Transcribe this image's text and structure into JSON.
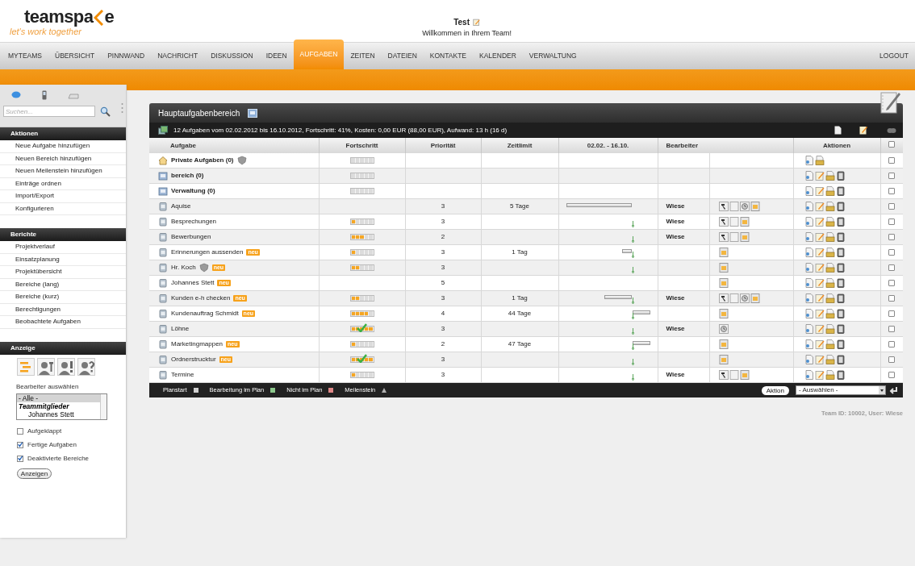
{
  "logo": {
    "text_start": "teamspa",
    "text_end": "e",
    "tagline": "let's work together"
  },
  "user": {
    "name": "Test",
    "welcome": "Willkommen in Ihrem Team!"
  },
  "nav": [
    {
      "label": "MYTEAMS",
      "selected": false
    },
    {
      "label": "ÜBERSICHT",
      "selected": false
    },
    {
      "label": "PINNWAND",
      "selected": false
    },
    {
      "label": "NACHRICHT",
      "selected": false
    },
    {
      "label": "DISKUSSION",
      "selected": false
    },
    {
      "label": "IDEEN",
      "selected": false
    },
    {
      "label": "AUFGABEN",
      "selected": true
    },
    {
      "label": "ZEITEN",
      "selected": false
    },
    {
      "label": "DATEIEN",
      "selected": false
    },
    {
      "label": "KONTAKTE",
      "selected": false
    },
    {
      "label": "KALENDER",
      "selected": false
    },
    {
      "label": "VERWALTUNG",
      "selected": false
    }
  ],
  "logout": "LOGOUT",
  "sidebar": {
    "search": {
      "placeholder": "Suchen..."
    },
    "sections": [
      {
        "title": "Aktionen",
        "items": [
          "Neue Aufgabe hinzufügen",
          "Neuen Bereich hinzufügen",
          "Neuen Meilenstein hinzufügen",
          "Einträge ordnen",
          "Import/Export",
          "Konfigurieren"
        ]
      },
      {
        "title": "Berichte",
        "items": [
          "Projektverlauf",
          "Einsatzplanung",
          "Projektübersicht",
          "Bereiche (lang)",
          "Bereiche (kurz)",
          "Berechtigungen",
          "Beobachtete Aufgaben"
        ]
      }
    ],
    "display": {
      "title": "Anzeige",
      "assignee_label": "Bearbeiter auswählen",
      "assignee_options": [
        {
          "label": "- Alle -",
          "kind": "option",
          "selected": true
        },
        {
          "label": "Teammitglieder",
          "kind": "group",
          "selected": false
        },
        {
          "label": "Johannes Stett",
          "kind": "option",
          "selected": false
        }
      ],
      "checkboxes": [
        {
          "label": "Aufgeklappt",
          "checked": false
        },
        {
          "label": "Fertige Aufgaben",
          "checked": true
        },
        {
          "label": "Deaktivierte Bereiche",
          "checked": true
        }
      ],
      "button": "Anzeigen"
    }
  },
  "panel": {
    "title": "Hauptaufgabenbereich",
    "summary": "12 Aufgaben vom 02.02.2012 bis 16.10.2012, Fortschritt: 41%, Kosten: 0,00 EUR (88,00 EUR), Aufwand: 13 h (16 d)",
    "columns": [
      "Aufgabe",
      "Fortschritt",
      "Priorität",
      "Zeitlimit",
      "02.02. - 16.10.",
      "Bearbeiter",
      "Aktionen"
    ],
    "select_all_checked": false,
    "rows": [
      {
        "name": "Private Aufgaben (0)",
        "kind": "home",
        "shield": true,
        "progress": {
          "level": 0,
          "done": false
        },
        "status_icons": [],
        "actions": [
          {
            "kind": "view"
          },
          {
            "kind": "folder"
          }
        ],
        "checked": false
      },
      {
        "name": "bereich (0)",
        "kind": "area",
        "shield": false,
        "progress": {
          "level": 0,
          "done": false
        },
        "status_icons": [],
        "actions": [
          {
            "kind": "view"
          },
          {
            "kind": "edit"
          },
          {
            "kind": "folder"
          },
          {
            "kind": "delete"
          }
        ],
        "checked": false
      },
      {
        "name": "Verwaltung (0)",
        "kind": "area",
        "shield": false,
        "progress": {
          "level": 0,
          "done": false
        },
        "status_icons": [],
        "actions": [
          {
            "kind": "view"
          },
          {
            "kind": "edit"
          },
          {
            "kind": "folder"
          },
          {
            "kind": "delete"
          }
        ],
        "checked": false
      },
      {
        "name": "Aquise",
        "kind": "task",
        "shield": false,
        "priority": "3",
        "time_limit": "5 Tage",
        "timeline": {
          "kind": "past-long"
        },
        "assignee": "Wiese",
        "status_icons": [
          {
            "kind": "hammer"
          },
          {
            "kind": "paper"
          },
          {
            "kind": "clock"
          },
          {
            "kind": "jar"
          }
        ],
        "actions": [
          {
            "kind": "view"
          },
          {
            "kind": "edit"
          },
          {
            "kind": "folder"
          },
          {
            "kind": "delete"
          }
        ],
        "checked": false
      },
      {
        "name": "Besprechungen",
        "kind": "task",
        "shield": false,
        "progress": {
          "level": 0.2,
          "done": false
        },
        "priority": "3",
        "timeline": {
          "kind": "marker"
        },
        "assignee": "Wiese",
        "status_icons": [
          {
            "kind": "hammer"
          },
          {
            "kind": "paper"
          },
          {
            "kind": "jar"
          }
        ],
        "actions": [
          {
            "kind": "view"
          },
          {
            "kind": "edit"
          },
          {
            "kind": "folder"
          },
          {
            "kind": "delete"
          }
        ],
        "checked": false
      },
      {
        "name": "Bewerbungen",
        "kind": "task",
        "shield": false,
        "progress": {
          "level": 0.6,
          "done": false
        },
        "priority": "2",
        "timeline": {
          "kind": "marker"
        },
        "assignee": "Wiese",
        "status_icons": [
          {
            "kind": "hammer"
          },
          {
            "kind": "paper"
          },
          {
            "kind": "jar"
          }
        ],
        "actions": [
          {
            "kind": "view"
          },
          {
            "kind": "edit"
          },
          {
            "kind": "folder"
          },
          {
            "kind": "delete"
          }
        ],
        "checked": false
      },
      {
        "name": "Erinnerungen aussenden",
        "kind": "task",
        "shield": false,
        "badge": "neu",
        "progress": {
          "level": 0.2,
          "done": false
        },
        "priority": "3",
        "time_limit": "1 Tag",
        "timeline": {
          "kind": "past-tiny"
        },
        "status_icons": [
          {
            "kind": "jar"
          }
        ],
        "actions": [
          {
            "kind": "view"
          },
          {
            "kind": "edit"
          },
          {
            "kind": "folder"
          },
          {
            "kind": "delete"
          }
        ],
        "checked": false
      },
      {
        "name": "Hr. Koch",
        "kind": "task",
        "shield": true,
        "badge": "neu",
        "progress": {
          "level": 0.4,
          "done": false
        },
        "priority": "3",
        "timeline": {
          "kind": "marker"
        },
        "status_icons": [
          {
            "kind": "jar"
          }
        ],
        "actions": [
          {
            "kind": "view"
          },
          {
            "kind": "edit"
          },
          {
            "kind": "folder"
          },
          {
            "kind": "delete"
          }
        ],
        "checked": false
      },
      {
        "name": "Johannes Stett",
        "kind": "task",
        "shield": false,
        "badge": "neu",
        "priority": "5",
        "status_icons": [
          {
            "kind": "jar"
          }
        ],
        "actions": [
          {
            "kind": "view"
          },
          {
            "kind": "edit"
          },
          {
            "kind": "folder"
          },
          {
            "kind": "delete"
          }
        ],
        "checked": false
      },
      {
        "name": "Kunden e-h checken",
        "kind": "task",
        "shield": false,
        "badge": "neu",
        "progress": {
          "level": 0.4,
          "done": false
        },
        "priority": "3",
        "time_limit": "1 Tag",
        "timeline": {
          "kind": "past-medium"
        },
        "assignee": "Wiese",
        "status_icons": [
          {
            "kind": "hammer"
          },
          {
            "kind": "paper"
          },
          {
            "kind": "clock"
          },
          {
            "kind": "jar"
          }
        ],
        "actions": [
          {
            "kind": "view"
          },
          {
            "kind": "edit"
          },
          {
            "kind": "folder"
          },
          {
            "kind": "delete"
          }
        ],
        "checked": false
      },
      {
        "name": "Kundenauftrag Schmidt",
        "kind": "task",
        "shield": false,
        "badge": "neu",
        "progress": {
          "level": 0.8,
          "done": false
        },
        "priority": "4",
        "time_limit": "44 Tage",
        "timeline": {
          "kind": "future-short"
        },
        "status_icons": [
          {
            "kind": "jar"
          }
        ],
        "actions": [
          {
            "kind": "view"
          },
          {
            "kind": "edit"
          },
          {
            "kind": "folder"
          },
          {
            "kind": "delete"
          }
        ],
        "checked": false
      },
      {
        "name": "Löhne",
        "kind": "task",
        "shield": false,
        "progress": {
          "level": 1,
          "done": true
        },
        "priority": "3",
        "timeline": {
          "kind": "marker"
        },
        "assignee": "Wiese",
        "status_icons": [
          {
            "kind": "clock"
          }
        ],
        "actions": [
          {
            "kind": "view"
          },
          {
            "kind": "edit"
          },
          {
            "kind": "folder"
          },
          {
            "kind": "delete"
          }
        ],
        "checked": false
      },
      {
        "name": "Marketingmappen",
        "kind": "task",
        "shield": false,
        "badge": "neu",
        "progress": {
          "level": 0.2,
          "done": false
        },
        "priority": "2",
        "time_limit": "47 Tage",
        "timeline": {
          "kind": "future-short"
        },
        "status_icons": [
          {
            "kind": "jar"
          }
        ],
        "actions": [
          {
            "kind": "view"
          },
          {
            "kind": "edit"
          },
          {
            "kind": "folder"
          },
          {
            "kind": "delete"
          }
        ],
        "checked": false
      },
      {
        "name": "Ordnerstrucktur",
        "kind": "task",
        "shield": false,
        "badge": "neu",
        "progress": {
          "level": 1,
          "done": true
        },
        "priority": "3",
        "timeline": {
          "kind": "marker"
        },
        "status_icons": [
          {
            "kind": "jar"
          }
        ],
        "actions": [
          {
            "kind": "view"
          },
          {
            "kind": "edit"
          },
          {
            "kind": "folder"
          },
          {
            "kind": "delete"
          }
        ],
        "checked": false
      },
      {
        "name": "Termine",
        "kind": "task",
        "shield": false,
        "progress": {
          "level": 0.2,
          "done": false
        },
        "priority": "3",
        "timeline": {
          "kind": "marker"
        },
        "assignee": "Wiese",
        "status_icons": [
          {
            "kind": "hammer"
          },
          {
            "kind": "paper"
          },
          {
            "kind": "jar"
          }
        ],
        "actions": [
          {
            "kind": "view"
          },
          {
            "kind": "edit"
          },
          {
            "kind": "folder"
          },
          {
            "kind": "delete"
          }
        ],
        "checked": false
      }
    ],
    "legend": [
      {
        "label": "Planstart",
        "kind": "square",
        "color": "#d0d0d0"
      },
      {
        "label": "Bearbeitung im Plan",
        "kind": "square",
        "color": "#8cc88c"
      },
      {
        "label": "Nicht im Plan",
        "kind": "square",
        "color": "#e08888"
      },
      {
        "label": "Meilenstein",
        "kind": "triangle",
        "color": "#b0b0b0"
      }
    ],
    "action_button": "Aktion",
    "action_select": "- Auswählen -"
  },
  "footer": "Team ID: 10002, User: Wiese"
}
